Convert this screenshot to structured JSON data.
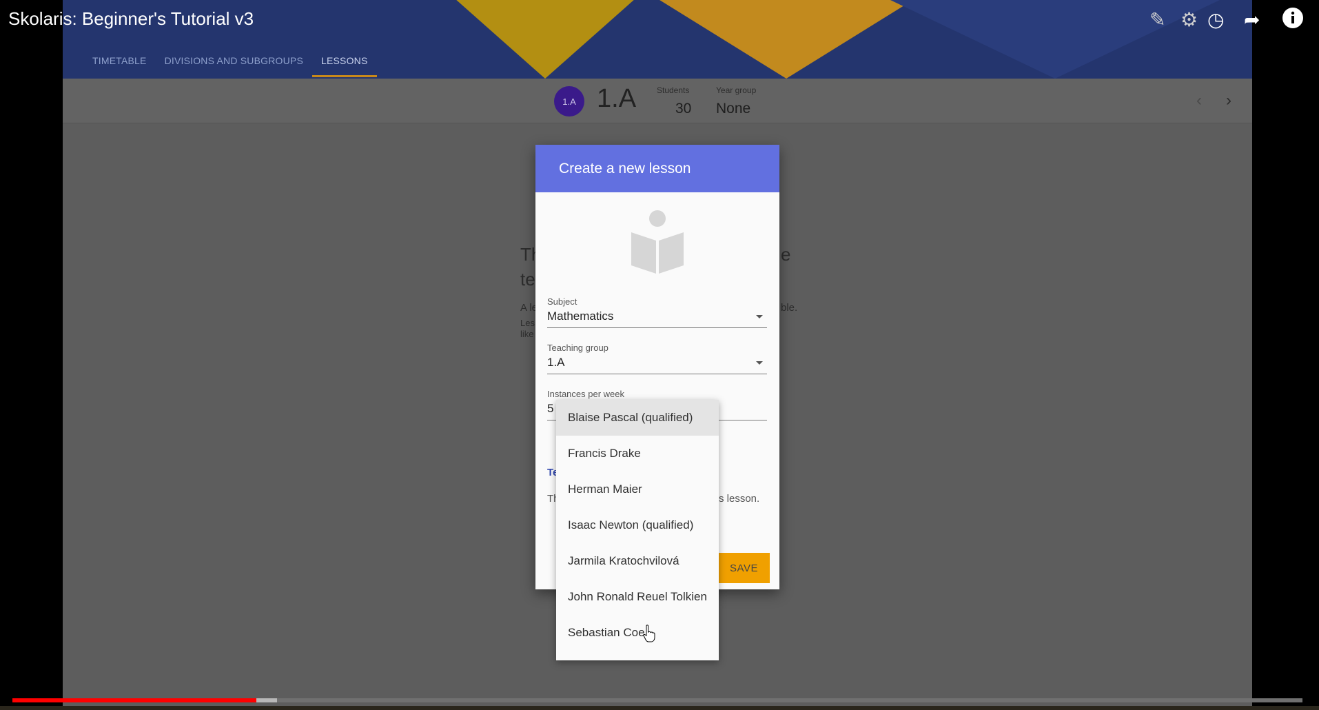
{
  "video": {
    "title": "Skolaris: Beginner's Tutorial v3",
    "icons": [
      "pencil-icon",
      "gear-icon",
      "clock-icon",
      "share-icon",
      "info-icon"
    ],
    "progress_fraction": 0.189,
    "buffer_fraction": 0.205
  },
  "app": {
    "tabs": [
      {
        "label": "TIMETABLE"
      },
      {
        "label": "DIVISIONS AND SUBGROUPS"
      },
      {
        "label": "LESSONS",
        "active": true
      }
    ],
    "classbar": {
      "avatar": "1.A",
      "name": "1.A",
      "students_label": "Students",
      "students_value": "30",
      "year_group_label": "Year group",
      "year_group_value": "None"
    },
    "background_fragments": {
      "heading_left_1": "Th",
      "heading_left_2": "te",
      "heading_right": "e",
      "line_1_left": "A le",
      "line_1_right": "ble.",
      "line_2_left": "Les",
      "line_3_left": "like"
    }
  },
  "dialog": {
    "title": "Create a new lesson",
    "subject_label": "Subject",
    "subject_value": "Mathematics",
    "teaching_group_label": "Teaching group",
    "teaching_group_value": "1.A",
    "instances_label": "Instances per week",
    "instances_value": "5",
    "teachers_fragment": "Te",
    "note_left": "Th",
    "note_right": "s lesson.",
    "save_label": "SAVE",
    "header_color": "#6270e0",
    "save_color": "#f0a000"
  },
  "dropdown": {
    "options": [
      "Blaise Pascal (qualified)",
      "Francis Drake",
      "Herman Maier",
      "Isaac Newton (qualified)",
      "Jarmila Kratochvilová",
      "John Ronald Reuel Tolkien",
      "Sebastian Coe"
    ],
    "highlighted_index": 0
  }
}
